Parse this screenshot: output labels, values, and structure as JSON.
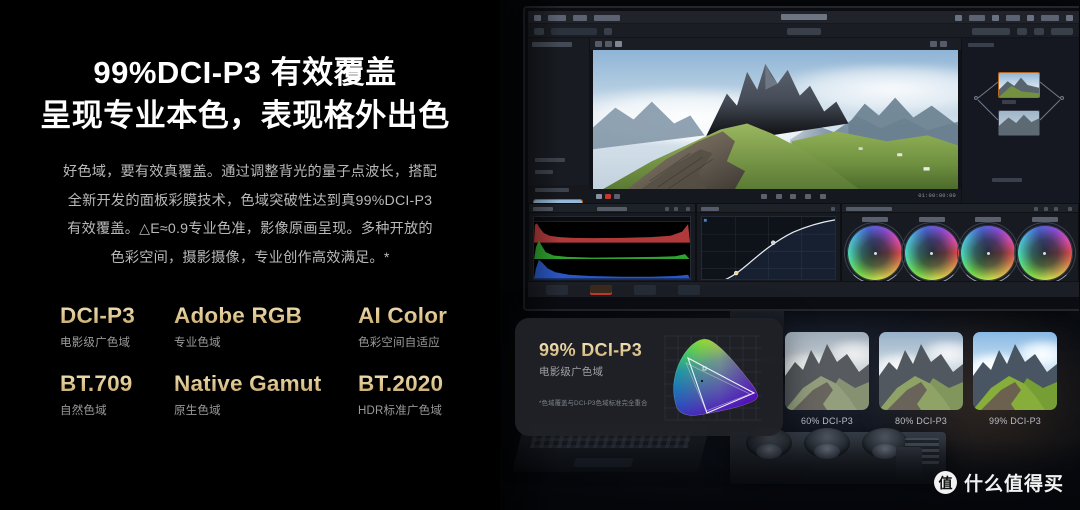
{
  "headline": {
    "line1": "99%DCI-P3 有效覆盖",
    "line2": "呈现专业本色，表现格外出色"
  },
  "body_copy": "好色域，要有效真覆盖。通过调整背光的量子点波长，搭配全新开发的面板彩膜技术，色域突破性达到真99%DCI-P3有效覆盖。△E≈0.9专业色准，影像原画呈现。多种开放的色彩空间，摄影摄像，专业创作高效满足。*",
  "gamuts": [
    {
      "title": "DCI-P3",
      "sub": "电影级广色域"
    },
    {
      "title": "Adobe RGB",
      "sub": "专业色域"
    },
    {
      "title": "AI Color",
      "sub": "色彩空间自适应"
    },
    {
      "title": "BT.709",
      "sub": "自然色域"
    },
    {
      "title": "Native Gamut",
      "sub": "原生色域"
    },
    {
      "title": "BT.2020",
      "sub": "HDR标准广色域"
    }
  ],
  "card": {
    "title": "99% DCI-P3",
    "subtitle": "电影级广色域",
    "note": "*色域覆盖与DCI-P3色域标准完全重合",
    "diagram": "cie-1931-chromaticity-diagram"
  },
  "comparison": [
    {
      "caption": "60% DCI-P3",
      "saturation_class": "sat60"
    },
    {
      "caption": "80% DCI-P3",
      "saturation_class": "sat80"
    },
    {
      "caption": "99% DCI-P3",
      "saturation_class": "sat99"
    }
  ],
  "app": {
    "viewer_timecode": "01:00:00:00",
    "image_subject": "seceda-dolomites-mountain-ridge"
  },
  "watermark": {
    "logo_glyph": "值",
    "text": "什么值得买"
  },
  "colors": {
    "background": "#000000",
    "gold_light": "#f2e3bd",
    "gold_dark": "#bd9e5f",
    "body_text": "#b9b9b9",
    "card_bg": "#1f2126",
    "accent_orange": "#b5651d"
  }
}
